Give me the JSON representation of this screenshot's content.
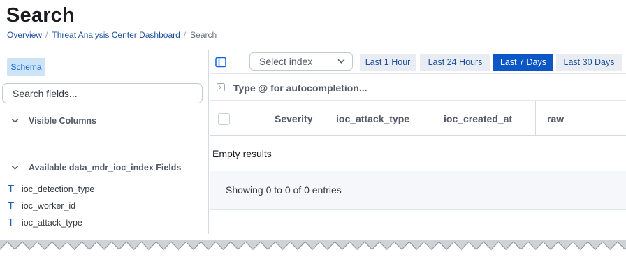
{
  "page": {
    "title": "Search"
  },
  "breadcrumb": [
    {
      "label": "Overview"
    },
    {
      "label": "Threat Analysis Center Dashboard"
    },
    {
      "label": "Search"
    }
  ],
  "sidebar": {
    "schema_tab": "Schema",
    "search_placeholder": "Search fields...",
    "visible_columns_label": "Visible Columns",
    "available_fields_label": "Available data_mdr_ioc_index Fields",
    "fields": [
      {
        "type": "T",
        "name": "ioc_detection_type"
      },
      {
        "type": "T",
        "name": "ioc_worker_id"
      },
      {
        "type": "T",
        "name": "ioc_attack_type"
      }
    ]
  },
  "toolbar": {
    "index_select_placeholder": "Select index",
    "time_ranges": [
      "Last 1 Hour",
      "Last 24 Hours",
      "Last 7 Days",
      "Last 30 Days"
    ],
    "active_time_range": "Last 7 Days"
  },
  "query": {
    "placeholder": "Type @ for autocompletion..."
  },
  "table": {
    "columns": [
      "Severity",
      "ioc_attack_type",
      "ioc_created_at",
      "raw"
    ],
    "empty_message": "Empty results",
    "footer_text": "Showing 0 to 0 of 0 entries"
  },
  "colors": {
    "accent": "#0b57c7",
    "link": "#1b4f9c",
    "schema_tab_bg": "#cce4f5",
    "time_btn_bg": "#e9edf3",
    "footer_bg": "#f5f7fa"
  }
}
